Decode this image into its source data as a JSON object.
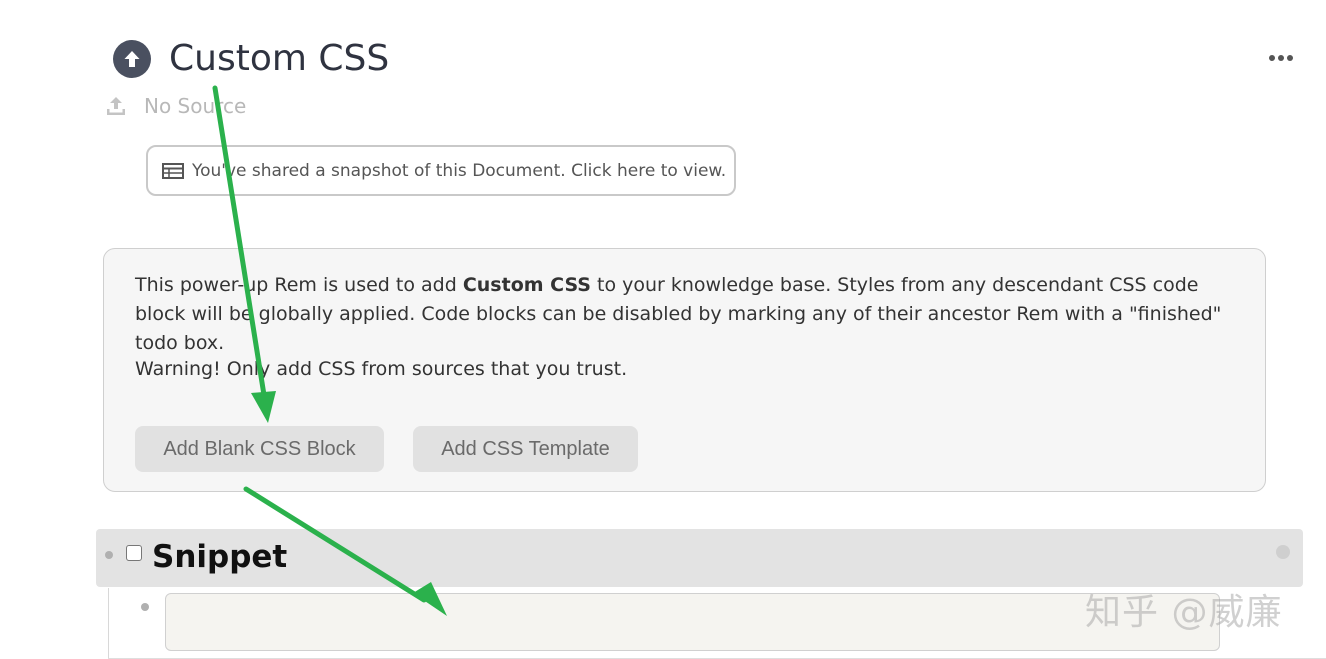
{
  "header": {
    "title": "Custom CSS",
    "source_text": "No Source"
  },
  "snapshot_banner": {
    "text": "You've shared a snapshot of this Document. Click here to view."
  },
  "info_card": {
    "text_before": "This power-up Rem is used to add ",
    "text_bold": "Custom CSS",
    "text_after": " to your knowledge base. Styles from any descendant CSS code block will be globally applied. Code blocks can be disabled by marking any of their ancestor Rem with a \"finished\" todo box.",
    "warning": "Warning! Only add CSS from sources that you trust.",
    "buttons": {
      "add_blank": "Add Blank CSS Block",
      "add_template": "Add CSS Template"
    }
  },
  "snippet": {
    "label": "Snippet",
    "checked": false
  },
  "watermark": "知乎 @威廉",
  "icons": {
    "title": "arrow-up-circle-icon",
    "more": "more-horizontal-icon",
    "upload": "upload-icon",
    "snapshot": "table-icon",
    "collapse": "collapse-circle-icon"
  },
  "colors": {
    "annotation_arrow": "#2bb14c",
    "card_background": "#f6f6f6",
    "button_background": "#e1e1e1",
    "snippet_row_background": "#e3e3e3"
  }
}
